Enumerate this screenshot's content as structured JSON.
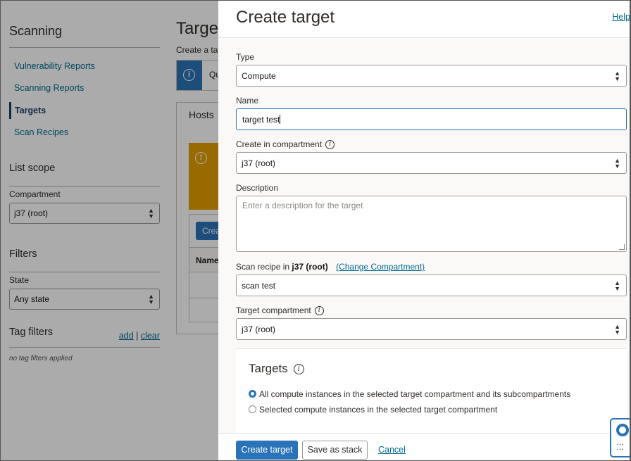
{
  "sidebar": {
    "title": "Scanning",
    "nav": [
      {
        "label": "Vulnerability Reports",
        "active": false
      },
      {
        "label": "Scanning Reports",
        "active": false
      },
      {
        "label": "Targets",
        "active": true
      },
      {
        "label": "Scan Recipes",
        "active": false
      }
    ],
    "list_scope": {
      "title": "List scope",
      "compartment_label": "Compartment",
      "compartment_value": "j37 (root)"
    },
    "filters": {
      "title": "Filters",
      "state_label": "State",
      "state_value": "Any state"
    },
    "tag_filters": {
      "title": "Tag filters",
      "add_label": "add",
      "separator": "|",
      "clear_label": "clear",
      "empty_text": "no tag filters applied"
    }
  },
  "main": {
    "title": "Targe",
    "subtitle": "Create a ta",
    "info_text": "Qu",
    "tab_label": "Hosts",
    "create_button_label": "Crea",
    "column_header": "Name"
  },
  "drawer": {
    "title": "Create target",
    "help_label": "Help",
    "type": {
      "label": "Type",
      "value": "Compute"
    },
    "name": {
      "label": "Name",
      "value": "target test"
    },
    "compartment": {
      "label": "Create in compartment",
      "value": "j37 (root)"
    },
    "description": {
      "label": "Description",
      "placeholder": "Enter a description for the target"
    },
    "scan_recipe": {
      "label_prefix": "Scan recipe in",
      "compartment_name": "j37 (root)",
      "change_link": "(Change Compartment)",
      "value": "scan test"
    },
    "target_compartment": {
      "label": "Target compartment",
      "value": "j37 (root)"
    },
    "targets": {
      "title": "Targets",
      "options": [
        {
          "label": "All compute instances in the selected target compartment and its subcompartments",
          "selected": true
        },
        {
          "label": "Selected compute instances in the selected target compartment",
          "selected": false
        }
      ]
    },
    "footer": {
      "create_label": "Create target",
      "save_stack_label": "Save as stack",
      "cancel_label": "Cancel"
    }
  },
  "colors": {
    "primary": "#2a73b8",
    "link": "#006b8f",
    "warning": "#e59e00",
    "overlay": "rgba(0,0,0,0.33)"
  },
  "icons": [
    "info-icon",
    "warning-icon",
    "chevron-updown-icon",
    "lifebuoy-icon",
    "grid-dots-icon"
  ]
}
